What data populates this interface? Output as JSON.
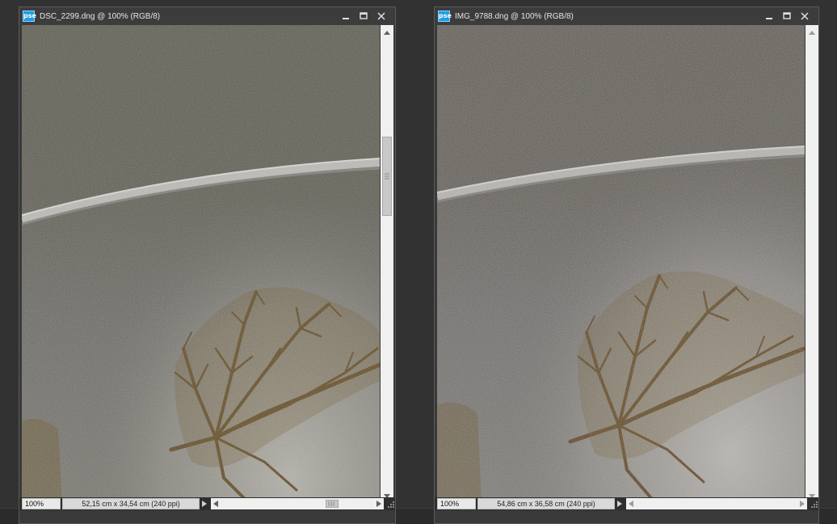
{
  "windows": [
    {
      "title": "DSC_2299.dng @ 100% (RGB/8)",
      "app_icon_text": "pse",
      "zoom": "100%",
      "doc_info": "52,15 cm x 34,54 cm (240 ppi)"
    },
    {
      "title": "IMG_9788.dng @ 100% (RGB/8)",
      "app_icon_text": "pse",
      "zoom": "100%",
      "doc_info": "54,86 cm x 36,58 cm (240 ppi)"
    }
  ],
  "icons": {
    "minimize": "minimize-icon",
    "maximize": "maximize-icon",
    "close": "close-icon",
    "scroll_up": "arrow-up-icon",
    "scroll_down": "arrow-down-icon",
    "scroll_left": "arrow-left-icon",
    "scroll_right": "arrow-right-icon",
    "doc_info_menu": "triangle-right-icon",
    "resize": "resize-grip-icon"
  },
  "colors": {
    "workspace_bg": "#323232",
    "app_badge": "#1f9de0",
    "photo_dark": "#5b584f",
    "photo_light": "#a7a59d",
    "leaf": "#6b5424"
  }
}
